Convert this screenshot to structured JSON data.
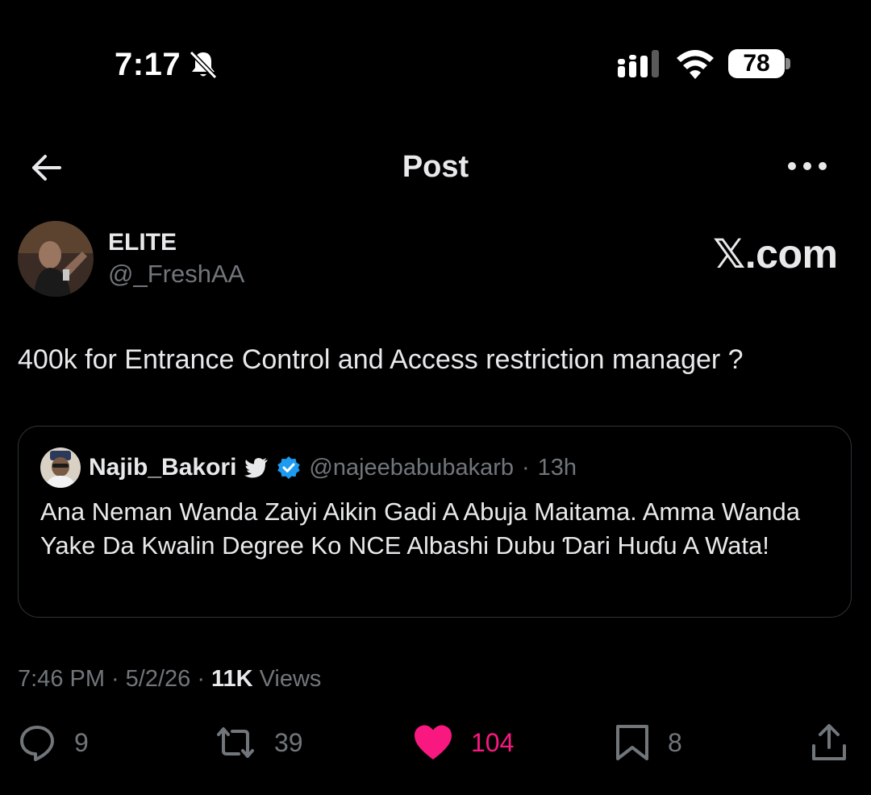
{
  "status_bar": {
    "time": "7:17",
    "battery_level": "78",
    "icons": [
      "bell-slash-icon",
      "cellular-signal-icon",
      "wifi-icon",
      "battery-icon"
    ]
  },
  "header": {
    "title": "Post",
    "back_icon": "arrow-left-icon",
    "more_icon": "more-horizontal-icon"
  },
  "post": {
    "author_name": "ELITE",
    "author_handle": "@_FreshAA",
    "watermark": "𝕏.com",
    "text": "400k for Entrance Control and Access restriction manager ?",
    "timestamp": "7:46 PM",
    "date": "5/2/26",
    "separator": "·",
    "views_count": "11K",
    "views_label": "Views"
  },
  "quote": {
    "author_name": "Najib_Bakori",
    "author_handle": "@najeebabubakarb",
    "separator": "·",
    "time_ago": "13h",
    "text": "Ana Neman Wanda Zaiyi Aikin Gadi A Abuja Maitama. Amma Wanda Yake Da Kwalin Degree Ko NCE Albashi Dubu Ɗari Huɗu A Wata!",
    "badges": [
      "bird-icon",
      "verified-badge-icon"
    ]
  },
  "actions": {
    "replies": "9",
    "reposts": "39",
    "likes": "104",
    "bookmarks": "8",
    "liked": true
  },
  "colors": {
    "background": "#000000",
    "text_primary": "#e7e9ea",
    "text_secondary": "#71767b",
    "like_pink": "#f91880",
    "verified_blue": "#1d9bf0",
    "border": "#2f3336"
  }
}
